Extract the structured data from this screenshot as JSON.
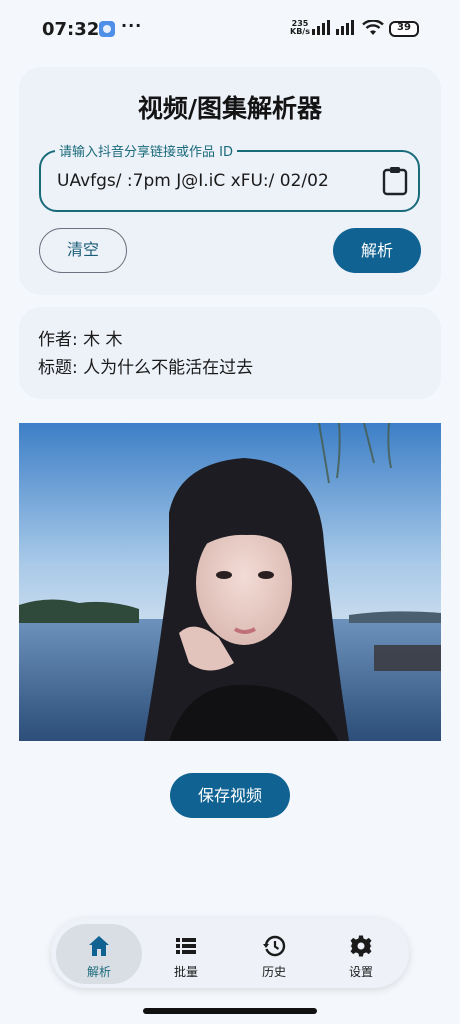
{
  "status_bar": {
    "time": "07:32",
    "more": "···",
    "net_speed_value": "235",
    "net_speed_unit": "KB/s",
    "battery": "39"
  },
  "parser": {
    "title": "视频/图集解析器",
    "input_label": "请输入抖音分享链接或作品 ID",
    "input_value": "UAvfgs/ :7pm J@I.iC xFU:/ 02/02",
    "clear_label": "清空",
    "parse_label": "解析"
  },
  "info": {
    "author_line": "作者: 木 木",
    "title_line": "标题: 人为什么不能活在过去"
  },
  "actions": {
    "save_label": "保存视频"
  },
  "nav": {
    "items": [
      {
        "label": "解析",
        "icon": "home-icon",
        "active": true
      },
      {
        "label": "批量",
        "icon": "list-icon",
        "active": false
      },
      {
        "label": "历史",
        "icon": "history-icon",
        "active": false
      },
      {
        "label": "设置",
        "icon": "gear-icon",
        "active": false
      }
    ]
  },
  "colors": {
    "accent": "#0f6291",
    "outline": "#1a6b7a",
    "card": "#edf1f8",
    "background": "#f4f7fb"
  }
}
